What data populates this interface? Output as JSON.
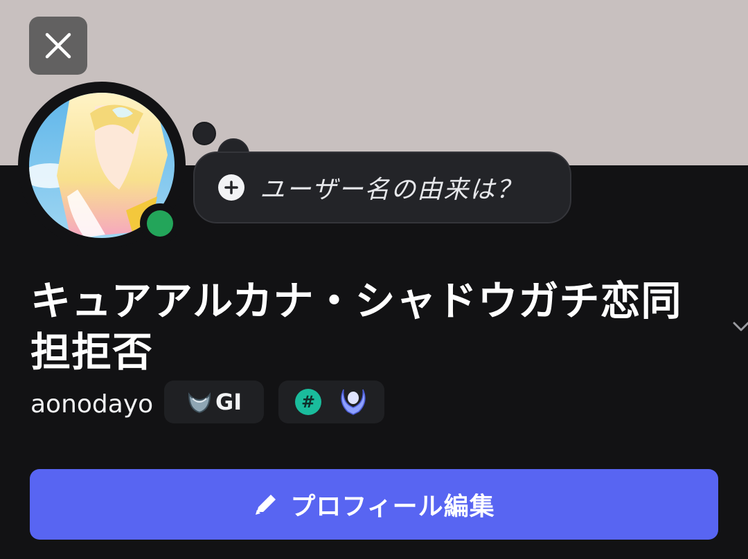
{
  "profile": {
    "display_name": "キュアアルカナ・シャドウガチ恋同担拒否",
    "username": "aonodayo",
    "thought_prompt": "ユーザー名の由来は？",
    "status": "online",
    "tag": {
      "text": "GI",
      "icon": "shield-crest-icon"
    },
    "badges": [
      {
        "name": "hash-badge",
        "label": "#",
        "color": "#1abc9c"
      },
      {
        "name": "laurel-badge",
        "icon": "laurel-wreath-icon",
        "color": "#8ea1ff"
      }
    ],
    "edit_button_label": "プロフィール編集"
  },
  "colors": {
    "banner": "#c8c0bf",
    "background": "#121214",
    "accent": "#5865f2",
    "online": "#23a55a"
  },
  "icons": {
    "close": "close-icon",
    "add": "plus-circle-icon",
    "edit": "pencil-icon",
    "expand": "chevron-down-icon"
  }
}
